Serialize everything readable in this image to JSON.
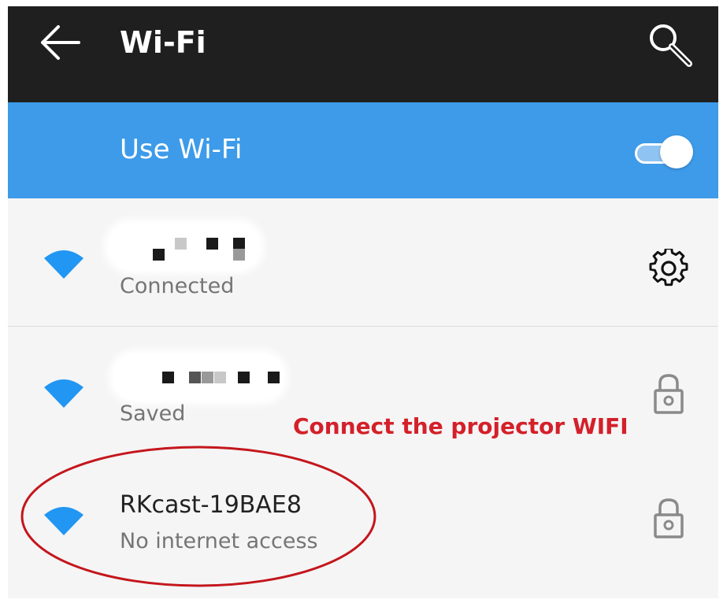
{
  "appbar": {
    "title": "Wi-Fi",
    "back_icon": "arrow-left-icon",
    "search_icon": "search-icon"
  },
  "wifi_toggle": {
    "label": "Use Wi-Fi",
    "state": "on"
  },
  "networks": [
    {
      "ssid": "",
      "ssid_obscured": true,
      "status": "Connected",
      "secured": false,
      "trailing_icon": "gear-icon"
    },
    {
      "ssid": "",
      "ssid_obscured": true,
      "status": "Saved",
      "secured": true,
      "trailing_icon": "lock-icon"
    },
    {
      "ssid": "RKcast-19BAE8",
      "ssid_obscured": false,
      "status": "No internet access",
      "secured": true,
      "trailing_icon": "lock-icon"
    }
  ],
  "annotation": {
    "text": "Connect the projector WIFI",
    "color": "#d4202a"
  },
  "colors": {
    "appbar": "#1f1f1f",
    "toggle_bar": "#3d9be9",
    "wifi_icon": "#2196f3",
    "background": "#f5f5f5"
  }
}
